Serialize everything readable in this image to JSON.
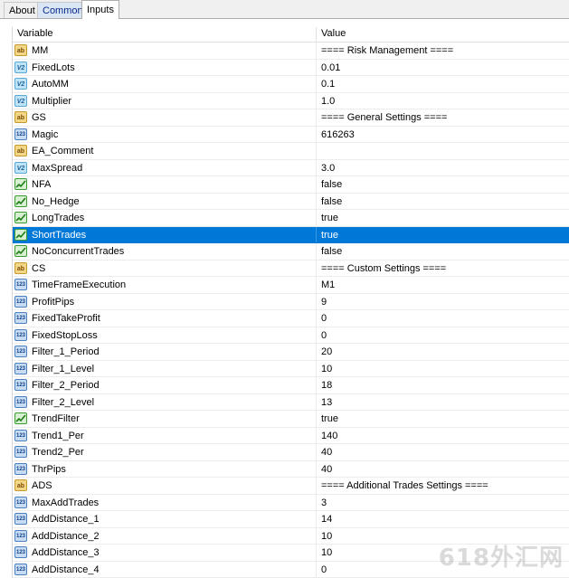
{
  "tabs": [
    {
      "label": "About",
      "active": false
    },
    {
      "label": "Common",
      "active": false
    },
    {
      "label": "Inputs",
      "active": true
    }
  ],
  "columns": {
    "variable": "Variable",
    "value": "Value"
  },
  "rows": [
    {
      "type": "string",
      "name": "MM",
      "value": "==== Risk Management ===="
    },
    {
      "type": "double",
      "name": "FixedLots",
      "value": "0.01"
    },
    {
      "type": "double",
      "name": "AutoMM",
      "value": "0.1"
    },
    {
      "type": "double",
      "name": "Multiplier",
      "value": "1.0"
    },
    {
      "type": "string",
      "name": "GS",
      "value": "==== General Settings ===="
    },
    {
      "type": "int",
      "name": "Magic",
      "value": "616263"
    },
    {
      "type": "string",
      "name": "EA_Comment",
      "value": ""
    },
    {
      "type": "double",
      "name": "MaxSpread",
      "value": "3.0"
    },
    {
      "type": "bool",
      "name": "NFA",
      "value": "false"
    },
    {
      "type": "bool",
      "name": "No_Hedge",
      "value": "false"
    },
    {
      "type": "bool",
      "name": "LongTrades",
      "value": "true"
    },
    {
      "type": "bool",
      "name": "ShortTrades",
      "value": "true",
      "selected": true
    },
    {
      "type": "bool",
      "name": "NoConcurrentTrades",
      "value": "false"
    },
    {
      "type": "string",
      "name": "CS",
      "value": "==== Custom Settings ===="
    },
    {
      "type": "int",
      "name": "TimeFrameExecution",
      "value": "M1"
    },
    {
      "type": "int",
      "name": "ProfitPips",
      "value": "9"
    },
    {
      "type": "int",
      "name": "FixedTakeProfit",
      "value": "0"
    },
    {
      "type": "int",
      "name": "FixedStopLoss",
      "value": "0"
    },
    {
      "type": "int",
      "name": "Filter_1_Period",
      "value": "20"
    },
    {
      "type": "int",
      "name": "Filter_1_Level",
      "value": "10"
    },
    {
      "type": "int",
      "name": "Filter_2_Period",
      "value": "18"
    },
    {
      "type": "int",
      "name": "Filter_2_Level",
      "value": "13"
    },
    {
      "type": "bool",
      "name": "TrendFilter",
      "value": "true"
    },
    {
      "type": "int",
      "name": "Trend1_Per",
      "value": "140"
    },
    {
      "type": "int",
      "name": "Trend2_Per",
      "value": "40"
    },
    {
      "type": "int",
      "name": "ThrPips",
      "value": "40"
    },
    {
      "type": "string",
      "name": "ADS",
      "value": "==== Additional Trades Settings ===="
    },
    {
      "type": "int",
      "name": "MaxAddTrades",
      "value": "3"
    },
    {
      "type": "int",
      "name": "AddDistance_1",
      "value": "14"
    },
    {
      "type": "int",
      "name": "AddDistance_2",
      "value": "10"
    },
    {
      "type": "int",
      "name": "AddDistance_3",
      "value": "10"
    },
    {
      "type": "int",
      "name": "AddDistance_4",
      "value": "0"
    }
  ],
  "icons": {
    "string": {
      "glyph": "ab",
      "icon": "string-type-icon"
    },
    "double": {
      "glyph": "V2",
      "icon": "double-type-icon"
    },
    "int": {
      "glyph": "123",
      "icon": "integer-type-icon"
    },
    "bool": {
      "glyph": "",
      "icon": "boolean-type-icon"
    }
  },
  "colors": {
    "selection": "#0078d7",
    "active_tab": "#ffffff",
    "common_tab": "#dbe6f5"
  },
  "watermark": "618外汇网"
}
